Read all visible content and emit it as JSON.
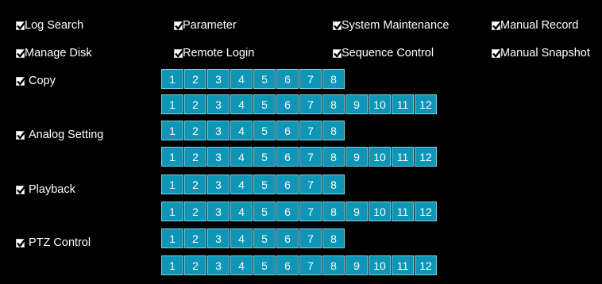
{
  "colors": {
    "background": "#000000",
    "text": "#ffffff",
    "channel_fill": "#0f95b6",
    "channel_border": "#7fd3e3",
    "checkbox_fill": "#ffffff",
    "checkmark": "#000000"
  },
  "icons": {
    "checkbox": "checkmark-icon"
  },
  "top_permissions": [
    {
      "label": "Log Search",
      "checked": true
    },
    {
      "label": "Parameter",
      "checked": true
    },
    {
      "label": "System Maintenance",
      "checked": true
    },
    {
      "label": "Manual Record",
      "checked": true
    },
    {
      "label": "Manage Disk",
      "checked": true
    },
    {
      "label": "Remote Login",
      "checked": true
    },
    {
      "label": "Sequence Control",
      "checked": true
    },
    {
      "label": "Manual Snapshot",
      "checked": true
    }
  ],
  "channel_permissions": [
    {
      "label": "Copy",
      "checked": true,
      "analog_channels": [
        "1",
        "2",
        "3",
        "4",
        "5",
        "6",
        "7",
        "8"
      ],
      "ip_channels": [
        "1",
        "2",
        "3",
        "4",
        "5",
        "6",
        "7",
        "8",
        "9",
        "10",
        "11",
        "12"
      ]
    },
    {
      "label": "Analog Setting",
      "checked": true,
      "analog_channels": [
        "1",
        "2",
        "3",
        "4",
        "5",
        "6",
        "7",
        "8"
      ],
      "ip_channels": [
        "1",
        "2",
        "3",
        "4",
        "5",
        "6",
        "7",
        "8",
        "9",
        "10",
        "11",
        "12"
      ]
    },
    {
      "label": "Playback",
      "checked": true,
      "analog_channels": [
        "1",
        "2",
        "3",
        "4",
        "5",
        "6",
        "7",
        "8"
      ],
      "ip_channels": [
        "1",
        "2",
        "3",
        "4",
        "5",
        "6",
        "7",
        "8",
        "9",
        "10",
        "11",
        "12"
      ]
    },
    {
      "label": "PTZ Control",
      "checked": true,
      "analog_channels": [
        "1",
        "2",
        "3",
        "4",
        "5",
        "6",
        "7",
        "8"
      ],
      "ip_channels": [
        "1",
        "2",
        "3",
        "4",
        "5",
        "6",
        "7",
        "8",
        "9",
        "10",
        "11",
        "12"
      ]
    }
  ]
}
